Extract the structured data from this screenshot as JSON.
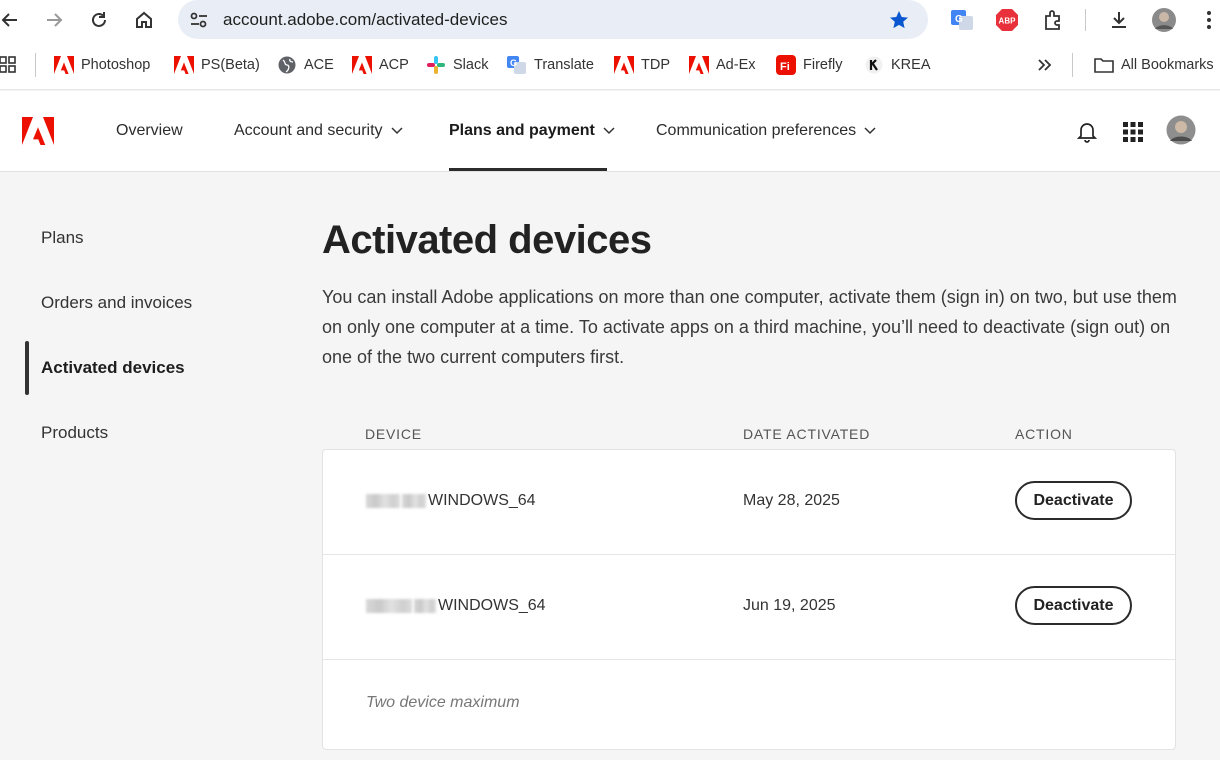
{
  "browser": {
    "url": "account.adobe.com/activated-devices",
    "bookmarks": [
      {
        "label": "Photoshop",
        "icon": "adobe-icon"
      },
      {
        "label": "PS(Beta)",
        "icon": "adobe-icon"
      },
      {
        "label": "ACE",
        "icon": "globe-icon"
      },
      {
        "label": "ACP",
        "icon": "adobe-icon"
      },
      {
        "label": "Slack",
        "icon": "slack-icon"
      },
      {
        "label": "Translate",
        "icon": "translate-icon"
      },
      {
        "label": "TDP",
        "icon": "adobe-icon"
      },
      {
        "label": "Ad-Ex",
        "icon": "adobe-icon"
      },
      {
        "label": "Firefly",
        "icon": "firefly-icon"
      },
      {
        "label": "KREA",
        "icon": "krea-icon"
      }
    ],
    "all_bookmarks": "All Bookmarks",
    "adblock_label": "ABP"
  },
  "nav": {
    "overview": "Overview",
    "account_security": "Account and security",
    "plans_payment": "Plans and payment",
    "communication": "Communication preferences"
  },
  "sidebar": {
    "items": [
      "Plans",
      "Orders and invoices",
      "Activated devices",
      "Products"
    ]
  },
  "main": {
    "title": "Activated devices",
    "description": "You can install Adobe applications on more than one computer, activate them (sign in) on two, but use them on only one computer at a time. To activate apps on a third machine, you’ll need to deactivate (sign out) on one of the two current computers first.",
    "columns": {
      "device": "DEVICE",
      "date": "DATE ACTIVATED",
      "action": "ACTION"
    },
    "devices": [
      {
        "name": "WINDOWS_64",
        "date": "May 28, 2025",
        "action": "Deactivate"
      },
      {
        "name": "WINDOWS_64",
        "date": "Jun 19, 2025",
        "action": "Deactivate"
      }
    ],
    "footer_note": "Two device maximum"
  },
  "colors": {
    "adobe_red": "#eb1000",
    "star_blue": "#0b57d0"
  }
}
